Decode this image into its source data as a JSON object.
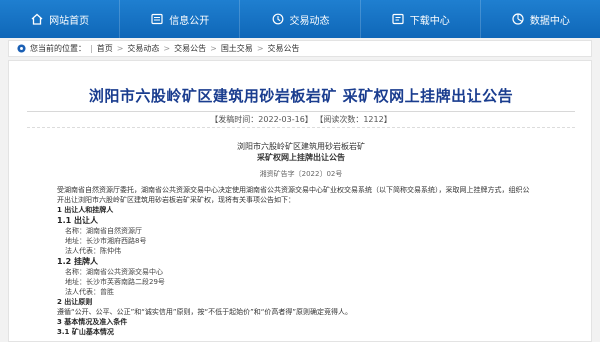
{
  "nav": [
    {
      "label": "网站首页",
      "icon": "home-icon",
      "name": "nav-home"
    },
    {
      "label": "信息公开",
      "icon": "info-icon",
      "name": "nav-info"
    },
    {
      "label": "交易动态",
      "icon": "trade-icon",
      "name": "nav-trade"
    },
    {
      "label": "下载中心",
      "icon": "download-icon",
      "name": "nav-download"
    },
    {
      "label": "数据中心",
      "icon": "data-icon",
      "name": "nav-data"
    }
  ],
  "breadcrumb": {
    "prefix": "您当前的位置：",
    "items": [
      "首页",
      "交易动态",
      "交易公告",
      "国土交易",
      "交易公告"
    ]
  },
  "article": {
    "title": "浏阳市六股岭矿区建筑用砂岩板岩矿 采矿权网上挂牌出让公告",
    "meta": "【发稿时间：2022-03-16】 【阅读次数：1212】",
    "head_line1": "浏阳市六股岭矿区建筑用砂岩板岩矿",
    "head_line2": "采矿权网上挂牌出让公告",
    "doc_no": "湘资矿告字〔2022〕02号",
    "intro_line1": "受湖南省自然资源厅委托，湖南省公共资源交易中心决定使用湖南省公共资源交易中心矿业权交易系统（以下简称交易系统），采取网上挂牌方式，组织公",
    "intro_line2": "开出让浏阳市六股岭矿区建筑用砂岩板岩矿采矿权，现将有关事项公告如下：",
    "s1": "1  出让人和挂牌人",
    "s11": "1.1  出让人",
    "s11_name": "名称：湖南省自然资源厅",
    "s11_addr": "地址：长沙市湘府西路8号",
    "s11_rep": "法人代表：陈仲伟",
    "s12": "1.2  挂牌人",
    "s12_name": "名称：湖南省公共资源交易中心",
    "s12_addr": "地址：长沙市芙蓉南路二段29号",
    "s12_rep": "法人代表：曾胜",
    "s2": "2  出让原则",
    "s2_text": "遵循“公开、公平、公正”和“诚实信用”原则，按“不低于起始价”和“价高者得”原则确定竞得人。",
    "s3": "3  基本情况及准入条件",
    "s31": "3.1  矿山基本情况"
  }
}
